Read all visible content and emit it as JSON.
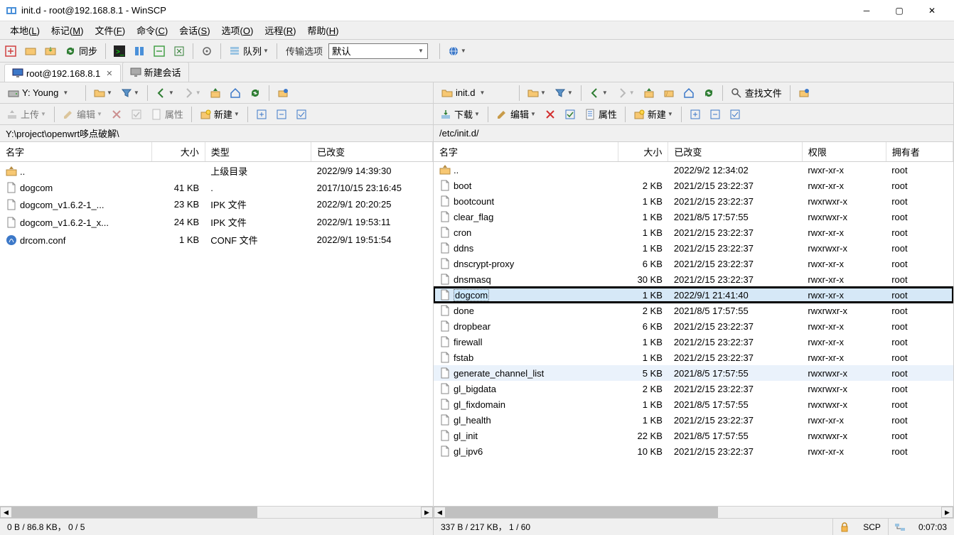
{
  "window": {
    "title": "init.d - root@192.168.8.1 - WinSCP"
  },
  "menubar": [
    "本地(L)",
    "标记(M)",
    "文件(F)",
    "命令(C)",
    "会话(S)",
    "选项(O)",
    "远程(R)",
    "帮助(H)"
  ],
  "toolbar1": {
    "sync_label": "同步",
    "queue_label": "队列",
    "transfer_option_label": "传输选项",
    "transfer_value": "默认"
  },
  "tabs": {
    "session": "root@192.168.8.1",
    "new_session": "新建会话"
  },
  "left": {
    "drive_label": "Y: Young",
    "path": "Y:\\project\\openwrt哆点破解\\",
    "actions": {
      "upload": "上传",
      "edit": "编辑",
      "props": "属性",
      "new": "新建"
    },
    "columns": {
      "name": "名字",
      "size": "大小",
      "type": "类型",
      "changed": "已改变"
    },
    "rows": [
      {
        "name": "..",
        "size": "",
        "type": "上级目录",
        "changed": "2022/9/9 14:39:30",
        "icon": "up"
      },
      {
        "name": "dogcom",
        "size": "41 KB",
        "type": ".",
        "changed": "2017/10/15 23:16:45",
        "icon": "file"
      },
      {
        "name": "dogcom_v1.6.2-1_...",
        "size": "23 KB",
        "type": "IPK 文件",
        "changed": "2022/9/1 20:20:25",
        "icon": "file"
      },
      {
        "name": "dogcom_v1.6.2-1_x...",
        "size": "24 KB",
        "type": "IPK 文件",
        "changed": "2022/9/1 19:53:11",
        "icon": "file"
      },
      {
        "name": "drcom.conf",
        "size": "1 KB",
        "type": "CONF 文件",
        "changed": "2022/9/1 19:51:54",
        "icon": "conf"
      }
    ],
    "status": "0 B / 86.8 KB， 0 / 5"
  },
  "right": {
    "drive_label": "init.d",
    "find_label": "查找文件",
    "path": "/etc/init.d/",
    "actions": {
      "download": "下载",
      "edit": "编辑",
      "props": "属性",
      "new": "新建"
    },
    "columns": {
      "name": "名字",
      "size": "大小",
      "changed": "已改变",
      "rights": "权限",
      "owner": "拥有者"
    },
    "rows": [
      {
        "name": "..",
        "size": "",
        "changed": "2022/9/2 12:34:02",
        "rights": "rwxr-xr-x",
        "owner": "root",
        "icon": "up"
      },
      {
        "name": "boot",
        "size": "2 KB",
        "changed": "2021/2/15 23:22:37",
        "rights": "rwxr-xr-x",
        "owner": "root",
        "icon": "file"
      },
      {
        "name": "bootcount",
        "size": "1 KB",
        "changed": "2021/2/15 23:22:37",
        "rights": "rwxrwxr-x",
        "owner": "root",
        "icon": "file"
      },
      {
        "name": "clear_flag",
        "size": "1 KB",
        "changed": "2021/8/5 17:57:55",
        "rights": "rwxrwxr-x",
        "owner": "root",
        "icon": "file"
      },
      {
        "name": "cron",
        "size": "1 KB",
        "changed": "2021/2/15 23:22:37",
        "rights": "rwxr-xr-x",
        "owner": "root",
        "icon": "file"
      },
      {
        "name": "ddns",
        "size": "1 KB",
        "changed": "2021/2/15 23:22:37",
        "rights": "rwxrwxr-x",
        "owner": "root",
        "icon": "file"
      },
      {
        "name": "dnscrypt-proxy",
        "size": "6 KB",
        "changed": "2021/2/15 23:22:37",
        "rights": "rwxr-xr-x",
        "owner": "root",
        "icon": "file"
      },
      {
        "name": "dnsmasq",
        "size": "30 KB",
        "changed": "2021/2/15 23:22:37",
        "rights": "rwxr-xr-x",
        "owner": "root",
        "icon": "file"
      },
      {
        "name": "dogcom",
        "size": "1 KB",
        "changed": "2022/9/1 21:41:40",
        "rights": "rwxr-xr-x",
        "owner": "root",
        "icon": "file",
        "selected": true,
        "highlighted": true
      },
      {
        "name": "done",
        "size": "2 KB",
        "changed": "2021/8/5 17:57:55",
        "rights": "rwxrwxr-x",
        "owner": "root",
        "icon": "file"
      },
      {
        "name": "dropbear",
        "size": "6 KB",
        "changed": "2021/2/15 23:22:37",
        "rights": "rwxr-xr-x",
        "owner": "root",
        "icon": "file"
      },
      {
        "name": "firewall",
        "size": "1 KB",
        "changed": "2021/2/15 23:22:37",
        "rights": "rwxr-xr-x",
        "owner": "root",
        "icon": "file"
      },
      {
        "name": "fstab",
        "size": "1 KB",
        "changed": "2021/2/15 23:22:37",
        "rights": "rwxr-xr-x",
        "owner": "root",
        "icon": "file"
      },
      {
        "name": "generate_channel_list",
        "size": "5 KB",
        "changed": "2021/8/5 17:57:55",
        "rights": "rwxrwxr-x",
        "owner": "root",
        "icon": "file",
        "hover": true
      },
      {
        "name": "gl_bigdata",
        "size": "2 KB",
        "changed": "2021/2/15 23:22:37",
        "rights": "rwxrwxr-x",
        "owner": "root",
        "icon": "file"
      },
      {
        "name": "gl_fixdomain",
        "size": "1 KB",
        "changed": "2021/8/5 17:57:55",
        "rights": "rwxrwxr-x",
        "owner": "root",
        "icon": "file"
      },
      {
        "name": "gl_health",
        "size": "1 KB",
        "changed": "2021/2/15 23:22:37",
        "rights": "rwxr-xr-x",
        "owner": "root",
        "icon": "file"
      },
      {
        "name": "gl_init",
        "size": "22 KB",
        "changed": "2021/8/5 17:57:55",
        "rights": "rwxrwxr-x",
        "owner": "root",
        "icon": "file"
      },
      {
        "name": "gl_ipv6",
        "size": "10 KB",
        "changed": "2021/2/15 23:22:37",
        "rights": "rwxr-xr-x",
        "owner": "root",
        "icon": "file"
      }
    ],
    "status": "337 B / 217 KB， 1 / 60"
  },
  "statusbar": {
    "protocol": "SCP",
    "time": "0:07:03"
  }
}
